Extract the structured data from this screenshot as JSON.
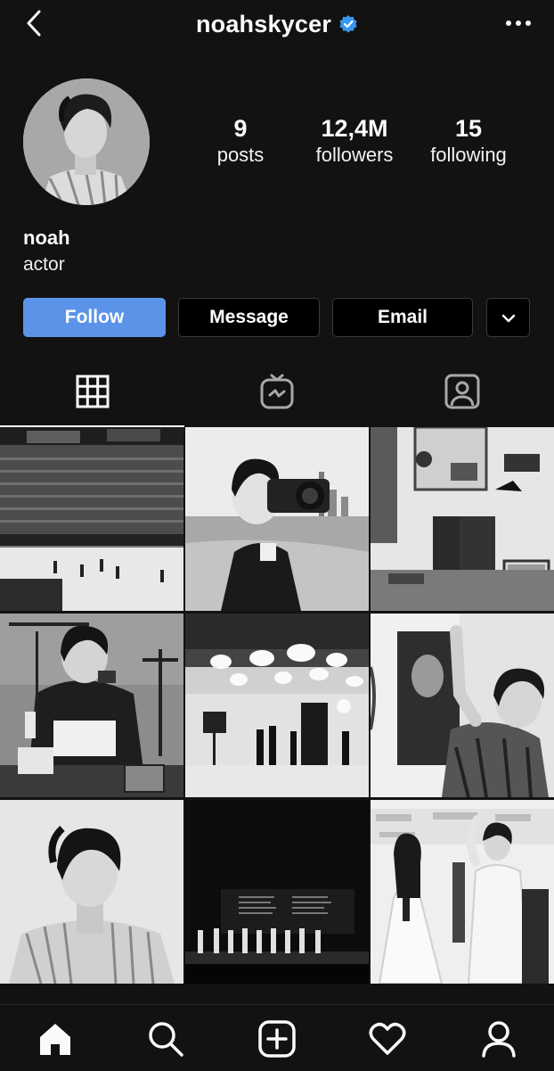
{
  "header": {
    "username": "noahskycer",
    "verified_color": "#3897f0",
    "back_icon": "chevron-left-icon",
    "more_icon": "more-horizontal-icon"
  },
  "profile": {
    "avatar_icon": "profile-photo",
    "stats": [
      {
        "value": "9",
        "label": "posts"
      },
      {
        "value": "12,4M",
        "label": "followers"
      },
      {
        "value": "15",
        "label": "following"
      }
    ],
    "name": "noah",
    "bio": "actor"
  },
  "actions": {
    "follow": "Follow",
    "message": "Message",
    "email": "Email",
    "follow_color": "#5b93e8"
  },
  "tabs": [
    {
      "icon": "grid-icon",
      "active": true
    },
    {
      "icon": "igtv-icon",
      "active": false
    },
    {
      "icon": "tagged-person-icon",
      "active": false
    }
  ],
  "posts": [
    {
      "subject": "hockey-arena"
    },
    {
      "subject": "camera-beach"
    },
    {
      "subject": "desk-studio"
    },
    {
      "subject": "radio-microphone"
    },
    {
      "subject": "photo-studio-lights"
    },
    {
      "subject": "portrait-hand-on-face"
    },
    {
      "subject": "portrait-striped-shirt"
    },
    {
      "subject": "stage-premiere"
    },
    {
      "subject": "red-carpet-event"
    }
  ],
  "bottom_nav": [
    {
      "icon": "home-icon"
    },
    {
      "icon": "search-icon"
    },
    {
      "icon": "add-post-icon"
    },
    {
      "icon": "heart-icon"
    },
    {
      "icon": "profile-icon"
    }
  ]
}
